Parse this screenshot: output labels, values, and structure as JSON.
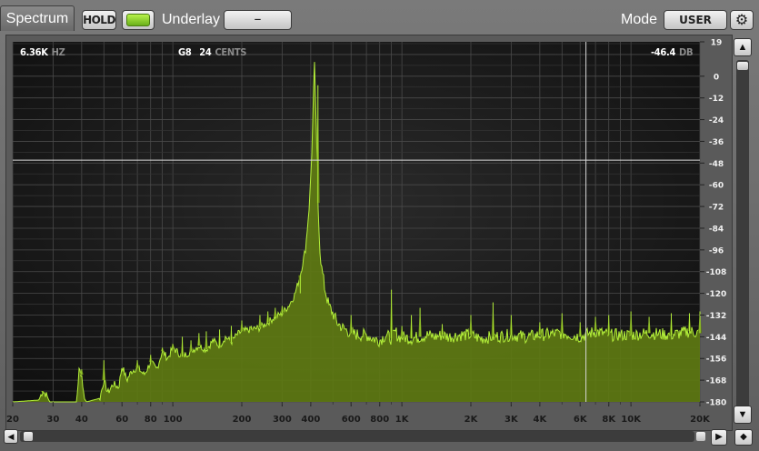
{
  "toolbar": {
    "tab_label": "Spectrum",
    "hold_label": "HOLD",
    "underlay_label": "Underlay",
    "underlay_value": "–",
    "mode_label": "Mode",
    "mode_value": "USER",
    "accent_color": "#9be02e"
  },
  "readouts": {
    "frequency_value": "6.36K",
    "frequency_unit": "HZ",
    "note_value": "G8",
    "cents_value": "24",
    "cents_unit": "CENTS",
    "level_value": "-46.4",
    "level_unit": "DB"
  },
  "icons": {
    "gear": "gear-icon",
    "up": "triangle-up-icon",
    "down": "triangle-down-icon",
    "play": "triangle-right-icon",
    "diamond": "diamond-icon"
  },
  "chart_data": {
    "type": "area",
    "x_scale": "log",
    "x_range_hz": [
      20,
      20000
    ],
    "y_range_db": [
      -180,
      19
    ],
    "x_ticks": [
      "20",
      "30",
      "40",
      "60",
      "80",
      "100",
      "200",
      "300",
      "400",
      "600",
      "800",
      "1K",
      "2K",
      "3K",
      "4K",
      "6K",
      "8K",
      "10K",
      "20K"
    ],
    "x_tick_values": [
      20,
      30,
      40,
      60,
      80,
      100,
      200,
      300,
      400,
      600,
      800,
      1000,
      2000,
      3000,
      4000,
      6000,
      8000,
      10000,
      20000
    ],
    "y_ticks": [
      "19",
      "0",
      "-12",
      "-24",
      "-36",
      "-48",
      "-60",
      "-72",
      "-84",
      "-96",
      "-108",
      "-120",
      "-132",
      "-144",
      "-156",
      "-168",
      "-180"
    ],
    "y_tick_values": [
      19,
      0,
      -12,
      -24,
      -36,
      -48,
      -60,
      -72,
      -84,
      -96,
      -108,
      -120,
      -132,
      -144,
      -156,
      -168,
      -180
    ],
    "cursor_hz": 6360,
    "cursor_db": -46.4,
    "fill_color": "#5e7a12",
    "line_color": "#b4f03a",
    "grid": true,
    "series": [
      {
        "x": [
          20,
          26,
          27,
          28,
          29,
          30,
          38,
          39,
          40,
          41,
          42,
          48,
          50,
          52,
          55,
          58,
          60,
          63,
          66,
          70,
          75,
          80,
          85,
          90,
          95,
          100,
          110,
          120,
          130,
          140,
          150,
          160,
          170,
          180,
          190,
          200,
          220,
          240,
          260,
          280,
          300,
          320,
          340,
          360,
          380,
          395,
          405,
          410,
          415,
          420,
          425,
          430,
          440,
          460,
          480,
          500,
          520,
          550,
          600,
          650,
          700,
          750,
          800,
          850,
          900,
          940,
          960,
          1000,
          1100,
          1200,
          1300,
          1400,
          1500,
          1600,
          1800,
          2000,
          2200,
          2500,
          3000,
          3500,
          4000,
          5000,
          6000,
          7000,
          8000,
          10000,
          12000,
          15000,
          18000,
          20000
        ],
        "y": [
          -180,
          -179,
          -174,
          -176,
          -180,
          -180,
          -180,
          -162,
          -165,
          -178,
          -180,
          -178,
          -168,
          -175,
          -170,
          -172,
          -160,
          -168,
          -163,
          -161,
          -165,
          -158,
          -162,
          -152,
          -156,
          -150,
          -155,
          -152,
          -149,
          -151,
          -146,
          -149,
          -144,
          -147,
          -143,
          -141,
          -140,
          -139,
          -136,
          -133,
          -131,
          -127,
          -121,
          -110,
          -95,
          -70,
          -40,
          -15,
          8,
          -15,
          -40,
          -70,
          -100,
          -117,
          -127,
          -131,
          -136,
          -139,
          -142,
          -143,
          -143,
          -145,
          -146,
          -143,
          -145,
          -141,
          -144,
          -144,
          -145,
          -144,
          -143,
          -144,
          -143,
          -144,
          -143,
          -143,
          -145,
          -144,
          -143,
          -144,
          -143,
          -142,
          -144,
          -141,
          -143,
          -143,
          -142,
          -143,
          -141,
          -142
        ],
        "peaks_hz": [
          27,
          40,
          50,
          60,
          70,
          80,
          90,
          100,
          110,
          120,
          130,
          140,
          160,
          180,
          200,
          220,
          240,
          260,
          280,
          300,
          330,
          360,
          430,
          600,
          900,
          1000,
          1100,
          1200,
          1500,
          2000,
          2500,
          3000,
          4000,
          5000,
          6000,
          7000,
          8000,
          10000,
          12000,
          15000,
          18000,
          20000
        ],
        "peaks_db": [
          -175,
          -162,
          -157,
          -160,
          -157,
          -154,
          -150,
          -148,
          -144,
          -146,
          -142,
          -141,
          -140,
          -138,
          -135,
          -138,
          -132,
          -130,
          -128,
          -127,
          -124,
          -120,
          -5,
          -132,
          -118,
          -138,
          -132,
          -128,
          -137,
          -132,
          -125,
          -132,
          -136,
          -131,
          -136,
          -133,
          -132,
          -130,
          -133,
          -131,
          -131,
          -130
        ]
      }
    ]
  }
}
